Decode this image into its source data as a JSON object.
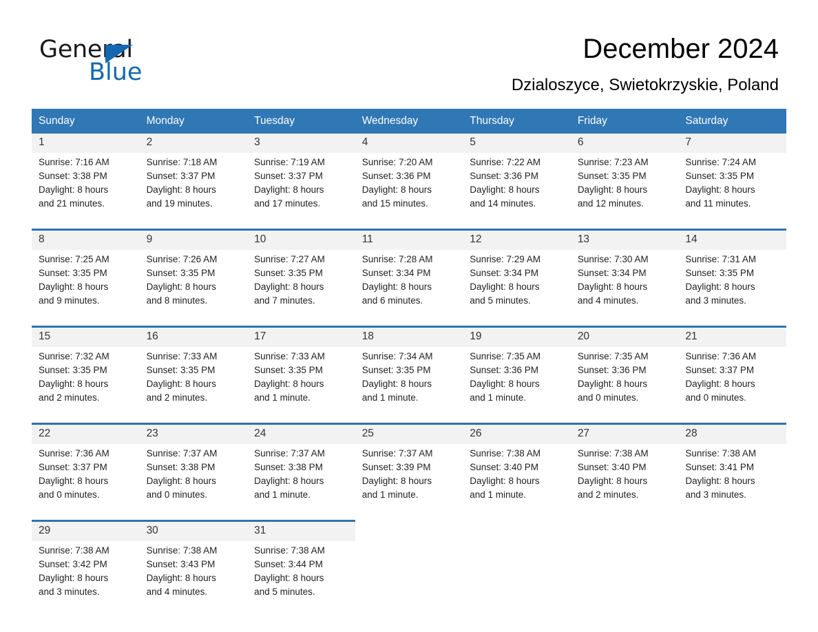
{
  "brand": {
    "name_part1": "General",
    "name_part2": "Blue",
    "accent_color": "#1268b3"
  },
  "header": {
    "title": "December 2024",
    "subtitle": "Dzialoszyce, Swietokrzyskie, Poland"
  },
  "calendar": {
    "header_bg": "#3077b5",
    "row_divider_color": "#2e74b2",
    "date_band_bg": "#f2f2f2",
    "weekday_headers": [
      "Sunday",
      "Monday",
      "Tuesday",
      "Wednesday",
      "Thursday",
      "Friday",
      "Saturday"
    ],
    "weeks": [
      [
        {
          "day": "1",
          "sunrise": "Sunrise: 7:16 AM",
          "sunset": "Sunset: 3:38 PM",
          "daylight_1": "Daylight: 8 hours",
          "daylight_2": "and 21 minutes."
        },
        {
          "day": "2",
          "sunrise": "Sunrise: 7:18 AM",
          "sunset": "Sunset: 3:37 PM",
          "daylight_1": "Daylight: 8 hours",
          "daylight_2": "and 19 minutes."
        },
        {
          "day": "3",
          "sunrise": "Sunrise: 7:19 AM",
          "sunset": "Sunset: 3:37 PM",
          "daylight_1": "Daylight: 8 hours",
          "daylight_2": "and 17 minutes."
        },
        {
          "day": "4",
          "sunrise": "Sunrise: 7:20 AM",
          "sunset": "Sunset: 3:36 PM",
          "daylight_1": "Daylight: 8 hours",
          "daylight_2": "and 15 minutes."
        },
        {
          "day": "5",
          "sunrise": "Sunrise: 7:22 AM",
          "sunset": "Sunset: 3:36 PM",
          "daylight_1": "Daylight: 8 hours",
          "daylight_2": "and 14 minutes."
        },
        {
          "day": "6",
          "sunrise": "Sunrise: 7:23 AM",
          "sunset": "Sunset: 3:35 PM",
          "daylight_1": "Daylight: 8 hours",
          "daylight_2": "and 12 minutes."
        },
        {
          "day": "7",
          "sunrise": "Sunrise: 7:24 AM",
          "sunset": "Sunset: 3:35 PM",
          "daylight_1": "Daylight: 8 hours",
          "daylight_2": "and 11 minutes."
        }
      ],
      [
        {
          "day": "8",
          "sunrise": "Sunrise: 7:25 AM",
          "sunset": "Sunset: 3:35 PM",
          "daylight_1": "Daylight: 8 hours",
          "daylight_2": "and 9 minutes."
        },
        {
          "day": "9",
          "sunrise": "Sunrise: 7:26 AM",
          "sunset": "Sunset: 3:35 PM",
          "daylight_1": "Daylight: 8 hours",
          "daylight_2": "and 8 minutes."
        },
        {
          "day": "10",
          "sunrise": "Sunrise: 7:27 AM",
          "sunset": "Sunset: 3:35 PM",
          "daylight_1": "Daylight: 8 hours",
          "daylight_2": "and 7 minutes."
        },
        {
          "day": "11",
          "sunrise": "Sunrise: 7:28 AM",
          "sunset": "Sunset: 3:34 PM",
          "daylight_1": "Daylight: 8 hours",
          "daylight_2": "and 6 minutes."
        },
        {
          "day": "12",
          "sunrise": "Sunrise: 7:29 AM",
          "sunset": "Sunset: 3:34 PM",
          "daylight_1": "Daylight: 8 hours",
          "daylight_2": "and 5 minutes."
        },
        {
          "day": "13",
          "sunrise": "Sunrise: 7:30 AM",
          "sunset": "Sunset: 3:34 PM",
          "daylight_1": "Daylight: 8 hours",
          "daylight_2": "and 4 minutes."
        },
        {
          "day": "14",
          "sunrise": "Sunrise: 7:31 AM",
          "sunset": "Sunset: 3:35 PM",
          "daylight_1": "Daylight: 8 hours",
          "daylight_2": "and 3 minutes."
        }
      ],
      [
        {
          "day": "15",
          "sunrise": "Sunrise: 7:32 AM",
          "sunset": "Sunset: 3:35 PM",
          "daylight_1": "Daylight: 8 hours",
          "daylight_2": "and 2 minutes."
        },
        {
          "day": "16",
          "sunrise": "Sunrise: 7:33 AM",
          "sunset": "Sunset: 3:35 PM",
          "daylight_1": "Daylight: 8 hours",
          "daylight_2": "and 2 minutes."
        },
        {
          "day": "17",
          "sunrise": "Sunrise: 7:33 AM",
          "sunset": "Sunset: 3:35 PM",
          "daylight_1": "Daylight: 8 hours",
          "daylight_2": "and 1 minute."
        },
        {
          "day": "18",
          "sunrise": "Sunrise: 7:34 AM",
          "sunset": "Sunset: 3:35 PM",
          "daylight_1": "Daylight: 8 hours",
          "daylight_2": "and 1 minute."
        },
        {
          "day": "19",
          "sunrise": "Sunrise: 7:35 AM",
          "sunset": "Sunset: 3:36 PM",
          "daylight_1": "Daylight: 8 hours",
          "daylight_2": "and 1 minute."
        },
        {
          "day": "20",
          "sunrise": "Sunrise: 7:35 AM",
          "sunset": "Sunset: 3:36 PM",
          "daylight_1": "Daylight: 8 hours",
          "daylight_2": "and 0 minutes."
        },
        {
          "day": "21",
          "sunrise": "Sunrise: 7:36 AM",
          "sunset": "Sunset: 3:37 PM",
          "daylight_1": "Daylight: 8 hours",
          "daylight_2": "and 0 minutes."
        }
      ],
      [
        {
          "day": "22",
          "sunrise": "Sunrise: 7:36 AM",
          "sunset": "Sunset: 3:37 PM",
          "daylight_1": "Daylight: 8 hours",
          "daylight_2": "and 0 minutes."
        },
        {
          "day": "23",
          "sunrise": "Sunrise: 7:37 AM",
          "sunset": "Sunset: 3:38 PM",
          "daylight_1": "Daylight: 8 hours",
          "daylight_2": "and 0 minutes."
        },
        {
          "day": "24",
          "sunrise": "Sunrise: 7:37 AM",
          "sunset": "Sunset: 3:38 PM",
          "daylight_1": "Daylight: 8 hours",
          "daylight_2": "and 1 minute."
        },
        {
          "day": "25",
          "sunrise": "Sunrise: 7:37 AM",
          "sunset": "Sunset: 3:39 PM",
          "daylight_1": "Daylight: 8 hours",
          "daylight_2": "and 1 minute."
        },
        {
          "day": "26",
          "sunrise": "Sunrise: 7:38 AM",
          "sunset": "Sunset: 3:40 PM",
          "daylight_1": "Daylight: 8 hours",
          "daylight_2": "and 1 minute."
        },
        {
          "day": "27",
          "sunrise": "Sunrise: 7:38 AM",
          "sunset": "Sunset: 3:40 PM",
          "daylight_1": "Daylight: 8 hours",
          "daylight_2": "and 2 minutes."
        },
        {
          "day": "28",
          "sunrise": "Sunrise: 7:38 AM",
          "sunset": "Sunset: 3:41 PM",
          "daylight_1": "Daylight: 8 hours",
          "daylight_2": "and 3 minutes."
        }
      ],
      [
        {
          "day": "29",
          "sunrise": "Sunrise: 7:38 AM",
          "sunset": "Sunset: 3:42 PM",
          "daylight_1": "Daylight: 8 hours",
          "daylight_2": "and 3 minutes."
        },
        {
          "day": "30",
          "sunrise": "Sunrise: 7:38 AM",
          "sunset": "Sunset: 3:43 PM",
          "daylight_1": "Daylight: 8 hours",
          "daylight_2": "and 4 minutes."
        },
        {
          "day": "31",
          "sunrise": "Sunrise: 7:38 AM",
          "sunset": "Sunset: 3:44 PM",
          "daylight_1": "Daylight: 8 hours",
          "daylight_2": "and 5 minutes."
        },
        {
          "day": "",
          "sunrise": "",
          "sunset": "",
          "daylight_1": "",
          "daylight_2": ""
        },
        {
          "day": "",
          "sunrise": "",
          "sunset": "",
          "daylight_1": "",
          "daylight_2": ""
        },
        {
          "day": "",
          "sunrise": "",
          "sunset": "",
          "daylight_1": "",
          "daylight_2": ""
        },
        {
          "day": "",
          "sunrise": "",
          "sunset": "",
          "daylight_1": "",
          "daylight_2": ""
        }
      ]
    ]
  }
}
